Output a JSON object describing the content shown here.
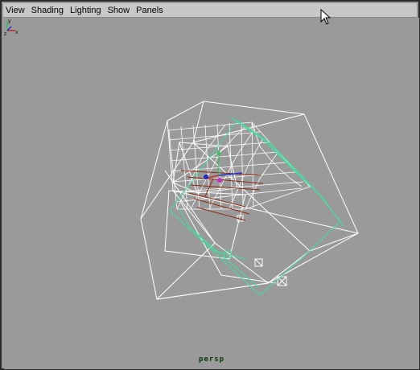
{
  "menu": {
    "items": [
      {
        "label": "View"
      },
      {
        "label": "Shading"
      },
      {
        "label": "Lighting"
      },
      {
        "label": "Show"
      },
      {
        "label": "Panels"
      }
    ]
  },
  "viewport": {
    "camera_label": "persp",
    "background_color": "#9a9a9a",
    "wire_color": "#ffffff",
    "selected_wire_color": "#3fe0a0",
    "curve_color": "#8b2a10"
  },
  "axis": {
    "x_label": "x",
    "y_label": "y",
    "z_label": "z"
  },
  "icons": {
    "cursor": "arrow-cursor-icon",
    "axis": "view-axis-icon"
  }
}
